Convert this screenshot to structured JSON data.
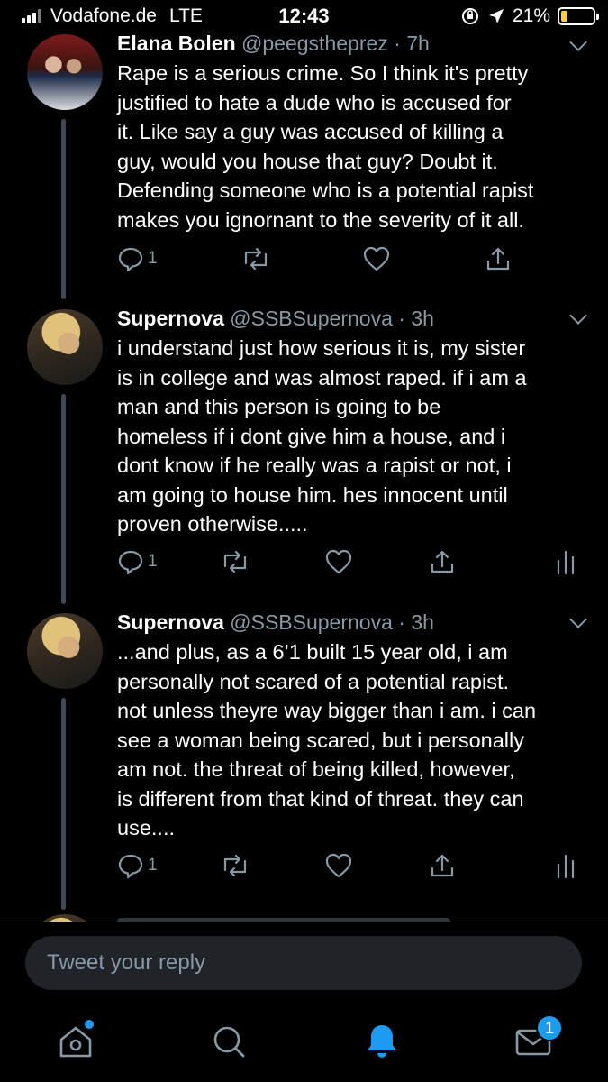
{
  "status": {
    "carrier": "Vodafone.de",
    "network": "LTE",
    "time": "12:43",
    "battery": "21%",
    "battery_level": 0.21
  },
  "tweets": [
    {
      "name": "Elana Bolen",
      "handle": "@peegstheprez",
      "time": "· 7h",
      "lines": [
        "Rape is a serious crime. So I think it's pretty",
        "justified to hate a dude who is accused for",
        "it. Like say a guy was accused of killing a",
        "guy, would you house that guy? Doubt it.",
        "Defending someone who is a potential rapist",
        "makes you ignornant to the severity of it all."
      ],
      "reply_count": "1"
    },
    {
      "name": "Supernova",
      "handle": "@SSBSupernova",
      "time": "· 3h",
      "lines": [
        "i understand just how serious it is, my sister",
        "is in college and was almost raped. if i am a",
        "man and this person is going to be",
        "homeless if i dont give him a house, and i",
        "dont know if he really was a rapist or not, i",
        "am going to house him. hes innocent until",
        "proven otherwise....."
      ],
      "reply_count": "1"
    },
    {
      "name": "Supernova",
      "handle": "@SSBSupernova",
      "time": "· 3h",
      "lines": [
        "...and plus, as a 6’1 built 15 year old, i am",
        "personally not scared of a potential rapist.",
        "not unless theyre way bigger than i am. i can",
        "see a woman being scared, but i personally",
        "am not. the threat of being killed, however,",
        "is different from that kind of threat. they can",
        "use...."
      ],
      "reply_count": "1"
    }
  ],
  "reply": {
    "placeholder": "Tweet your reply"
  },
  "tabbar": {
    "items": [
      "home-icon",
      "search-icon",
      "notifications-icon",
      "messages-icon"
    ],
    "messages_badge": "1"
  },
  "colors": {
    "accent": "#1d9bf0",
    "muted": "#8899a6",
    "thread": "#3d4a56",
    "input_bg": "#202327"
  }
}
